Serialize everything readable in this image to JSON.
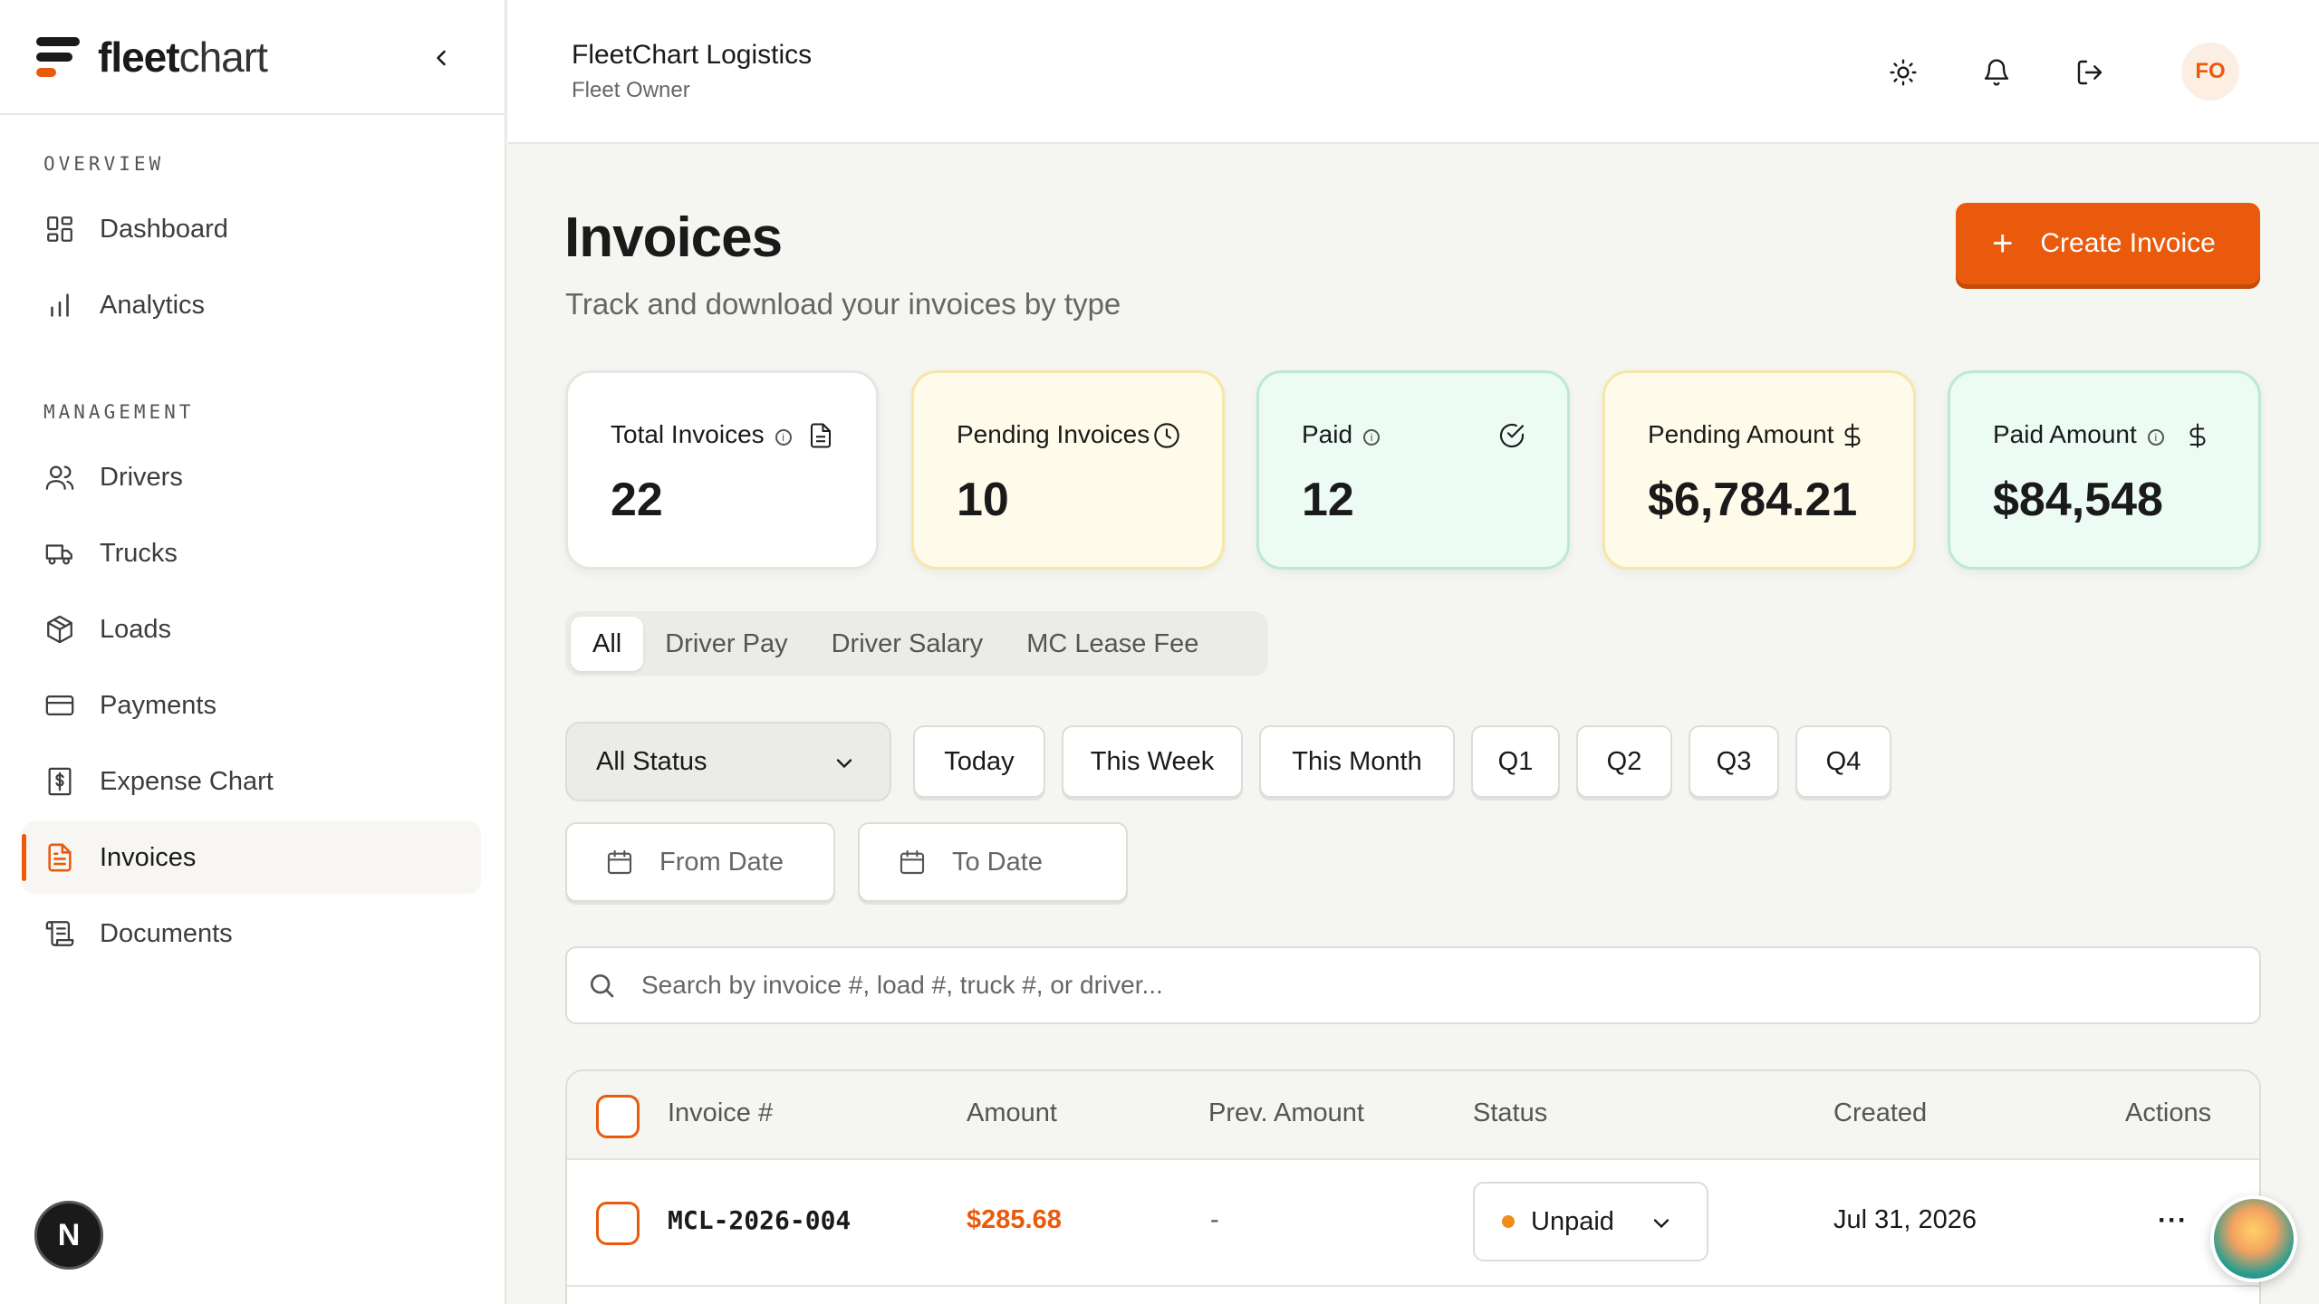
{
  "brand": {
    "bold": "fleet",
    "light": "chart"
  },
  "sidebar": {
    "sections": [
      {
        "title": "OVERVIEW",
        "items": [
          {
            "label": "Dashboard",
            "icon": "dashboard-icon"
          },
          {
            "label": "Analytics",
            "icon": "bar-chart-icon"
          }
        ]
      },
      {
        "title": "MANAGEMENT",
        "items": [
          {
            "label": "Drivers",
            "icon": "users-icon"
          },
          {
            "label": "Trucks",
            "icon": "truck-icon"
          },
          {
            "label": "Loads",
            "icon": "package-icon"
          },
          {
            "label": "Payments",
            "icon": "credit-card-icon"
          },
          {
            "label": "Expense Chart",
            "icon": "receipt-icon"
          },
          {
            "label": "Invoices",
            "icon": "file-text-icon",
            "active": true
          },
          {
            "label": "Documents",
            "icon": "scroll-icon"
          }
        ]
      }
    ],
    "dev_badge": "N"
  },
  "header": {
    "org_name": "FleetChart Logistics",
    "role": "Fleet Owner",
    "avatar_initials": "FO"
  },
  "page": {
    "title": "Invoices",
    "subtitle": "Track and download your invoices by type",
    "create_button": "Create Invoice"
  },
  "stats": [
    {
      "label": "Total Invoices",
      "value": "22",
      "info": true,
      "icon": "document-icon",
      "theme": "white"
    },
    {
      "label": "Pending Invoices",
      "value": "10",
      "info": false,
      "icon": "clock-icon",
      "theme": "yellow"
    },
    {
      "label": "Paid",
      "value": "12",
      "info": true,
      "icon": "check-circle-icon",
      "theme": "green"
    },
    {
      "label": "Pending Amount",
      "value": "$6,784.21",
      "info": false,
      "icon": "dollar-icon",
      "theme": "yellow"
    },
    {
      "label": "Paid Amount",
      "value": "$84,548",
      "info": true,
      "icon": "dollar-icon",
      "theme": "green"
    }
  ],
  "tabs": [
    "All",
    "Driver Pay",
    "Driver Salary",
    "MC Lease Fee"
  ],
  "active_tab": "All",
  "filters": {
    "status_value": "All Status",
    "quick": [
      "Today",
      "This Week",
      "This Month",
      "Q1",
      "Q2",
      "Q3",
      "Q4"
    ],
    "from_placeholder": "From Date",
    "to_placeholder": "To Date"
  },
  "search": {
    "placeholder": "Search by invoice #, load #, truck #, or driver..."
  },
  "table": {
    "columns": [
      "Invoice #",
      "Amount",
      "Prev. Amount",
      "Status",
      "Created",
      "Actions"
    ],
    "rows": [
      {
        "invoice": "MCL-2026-004",
        "amount": "$285.68",
        "prev_amount": "-",
        "status": "Unpaid",
        "created": "Jul 31, 2026",
        "actions": "···"
      }
    ]
  },
  "colors": {
    "accent": "#ea5a0c",
    "pending_bg": "#fffbea",
    "paid_bg": "#ecfbf3",
    "status_dot": "#f08c1a"
  }
}
